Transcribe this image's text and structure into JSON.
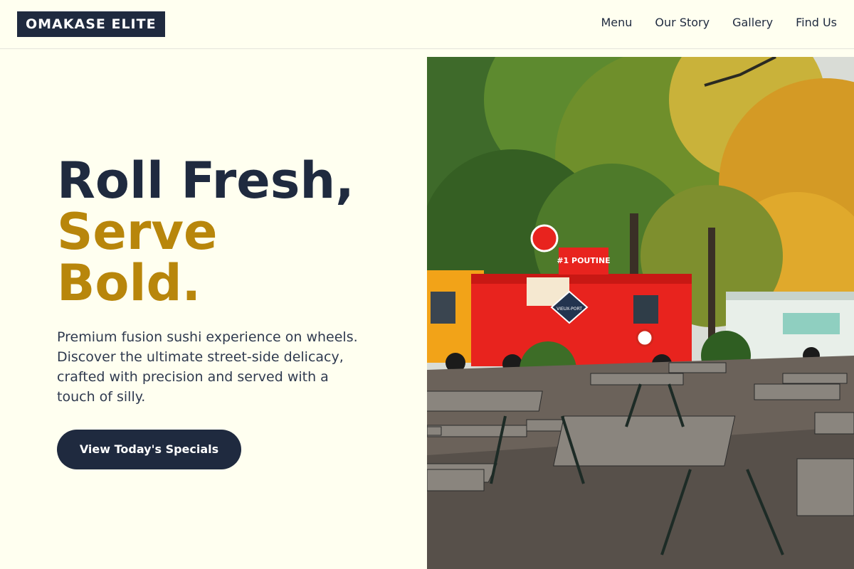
{
  "brand": {
    "logo_text": "OMAKASE ELITE"
  },
  "nav": {
    "items": [
      {
        "label": "Menu"
      },
      {
        "label": "Our Story"
      },
      {
        "label": "Gallery"
      },
      {
        "label": "Find Us"
      }
    ]
  },
  "hero": {
    "title_line1": "Roll Fresh,",
    "title_line2": "Serve",
    "title_line3": "Bold.",
    "description": "Premium fusion sushi experience on wheels. Discover the ultimate street-side delicacy, crafted with precision and served with a touch of silly.",
    "cta_label": "View Today's Specials"
  },
  "photo": {
    "truck_sign": "#1 POUTINE",
    "truck_badge": "VIEUX-PORT"
  },
  "colors": {
    "background": "#fffff0",
    "primary": "#1f2a3f",
    "accent": "#b8860b"
  }
}
